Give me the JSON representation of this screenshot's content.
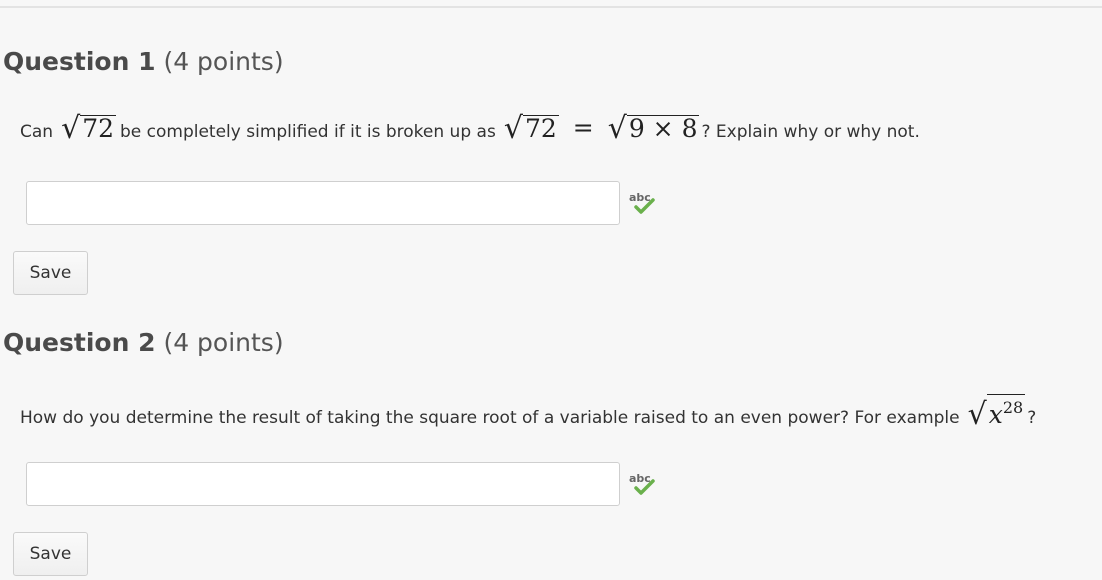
{
  "questions": [
    {
      "number_label": "Question 1",
      "points_label": "(4 points)",
      "text": {
        "part1": "Can",
        "sqrt_a": "72",
        "part2": "be completely simplified if it is broken up as",
        "sqrt_b": "72",
        "equals": "=",
        "sqrt_c": "9 × 8",
        "part3": "? Explain why or why not."
      },
      "answer": {
        "value": "",
        "placeholder": ""
      },
      "spellcheck_icon": "spellcheck-abc-icon",
      "save_label": "Save"
    },
    {
      "number_label": "Question 2",
      "points_label": "(4 points)",
      "text": {
        "part1": "How do you determine the result of taking the square root of a variable raised to an even power? For example",
        "sqrt_var": "x",
        "sqrt_exp": "28",
        "part2": "?"
      },
      "answer": {
        "value": "",
        "placeholder": ""
      },
      "spellcheck_icon": "spellcheck-abc-icon",
      "save_label": "Save"
    }
  ],
  "colors": {
    "background": "#f7f7f7",
    "check_green": "#6ab04c"
  }
}
